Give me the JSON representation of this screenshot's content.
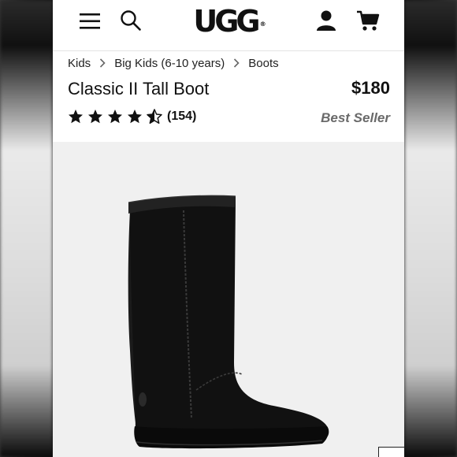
{
  "header": {
    "logo_text": "UGG",
    "logo_mark": "®",
    "icons": [
      "menu-icon",
      "search-icon",
      "account-icon",
      "cart-icon"
    ]
  },
  "breadcrumb": {
    "items": [
      "Kids",
      "Big Kids (6-10 years)",
      "Boots"
    ]
  },
  "product": {
    "title": "Classic II Tall Boot",
    "price": "$180",
    "rating": 4.5,
    "rating_max": 5,
    "review_count": "(154)",
    "badge": "Best Seller"
  },
  "colors": {
    "text": "#111111",
    "badge": "#6a6a6a",
    "image_bg": "#f0f0f0"
  }
}
